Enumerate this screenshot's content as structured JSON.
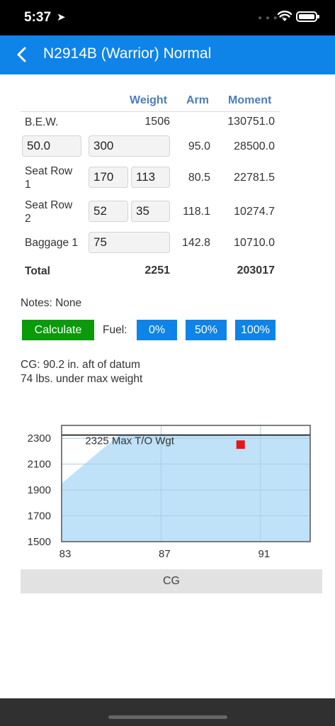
{
  "status": {
    "time": "5:37"
  },
  "nav": {
    "title": "N2914B (Warrior) Normal"
  },
  "columns": {
    "weight": "Weight",
    "arm": "Arm",
    "moment": "Moment"
  },
  "rows": {
    "bew": {
      "label": "B.E.W.",
      "weight": "1506",
      "moment": "130751.0"
    },
    "front": {
      "input_a": "50.0",
      "input_b": "300",
      "arm": "95.0",
      "moment": "28500.0"
    },
    "seat1": {
      "label": "Seat Row\n1",
      "input_a": "170",
      "input_b": "113",
      "arm": "80.5",
      "moment": "22781.5"
    },
    "seat2": {
      "label": "Seat Row\n2",
      "input_a": "52",
      "input_b": "35",
      "arm": "118.1",
      "moment": "10274.7"
    },
    "baggage": {
      "label": "Baggage 1",
      "input_a": "75",
      "arm": "142.8",
      "moment": "10710.0"
    },
    "total": {
      "label": "Total",
      "weight": "2251",
      "moment": "203017"
    }
  },
  "notes": "Notes: None",
  "actions": {
    "calculate": "Calculate",
    "fuel_label": "Fuel:",
    "fuel_options": [
      "0%",
      "50%",
      "100%"
    ]
  },
  "results": {
    "cg": "CG: 90.2 in. aft of datum",
    "weight": "74 lbs. under max weight"
  },
  "chart_data": {
    "type": "area",
    "title": "",
    "xlabel": "CG",
    "ylabel": "",
    "x_ticks": [
      "83",
      "87",
      "91"
    ],
    "y_ticks": [
      "2300",
      "2100",
      "1900",
      "1700",
      "1500"
    ],
    "xlim": [
      83,
      93
    ],
    "ylim": [
      1500,
      2400
    ],
    "max_weight_line": {
      "label": "2325 Max T/O Wgt",
      "value": 2325
    },
    "envelope": [
      [
        83,
        1950
      ],
      [
        85.3,
        2325
      ],
      [
        93,
        2325
      ],
      [
        93,
        1500
      ],
      [
        83,
        1500
      ]
    ],
    "current_point": {
      "x": 90.2,
      "y": 2251
    },
    "colors": {
      "envelope": "#bfe2f8",
      "point": "#e8141a",
      "limit_line": "#000000"
    },
    "grid": true
  }
}
